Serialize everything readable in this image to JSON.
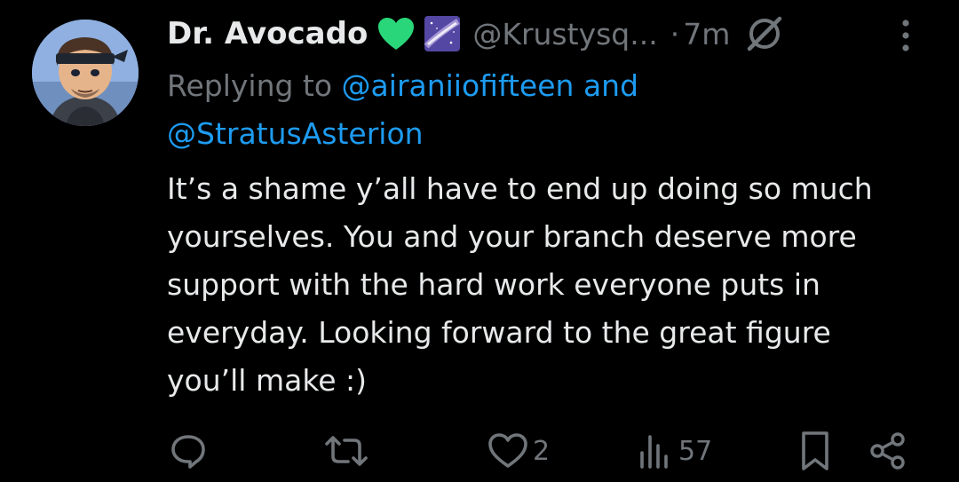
{
  "tweet": {
    "display_name": "Dr. Avocado",
    "name_emojis": [
      "green-heart-icon",
      "milky-way-icon"
    ],
    "handle": "@Krustysq...",
    "separator": "·",
    "time": "7m",
    "replying_prefix": "Replying to ",
    "mentions": [
      "@airaniiofifteen",
      "@StratusAsterion"
    ],
    "mention_joiner": " and",
    "body_lines": [
      "It’s a shame y’all have to end up doing so much",
      "yourselves. You and your branch deserve more",
      "support with the hard work everyone puts in",
      "everyday. Looking forward to the great figure",
      "you’ll make :)"
    ]
  },
  "actions": {
    "reply_count": "",
    "retweet_count": "",
    "like_count": "2",
    "views_count": "57"
  },
  "colors": {
    "background": "#000000",
    "text_primary": "#e7e9ea",
    "text_secondary": "#71767b",
    "link": "#1d9bf0",
    "heart_emoji": "#2ad67a"
  }
}
